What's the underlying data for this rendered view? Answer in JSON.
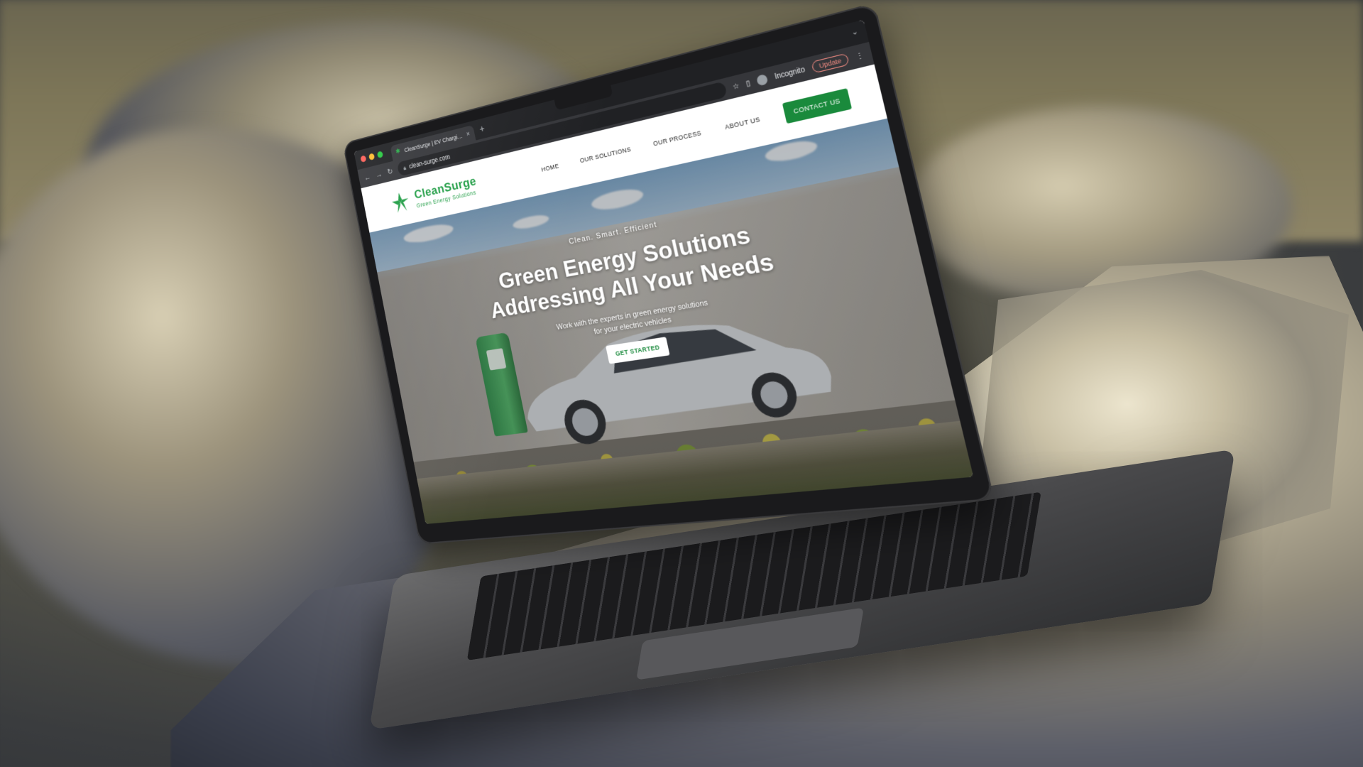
{
  "browser": {
    "tab_title": "CleanSurge | EV Charging, Sol",
    "tab_close": "×",
    "new_tab": "+",
    "chevron": "⌄",
    "url": "clean-surge.com",
    "incognito_label": "Incognito",
    "update_label": "Update"
  },
  "site": {
    "brand_name": "CleanSurge",
    "brand_tagline": "Green Energy Solutions",
    "nav": {
      "home": "HOME",
      "solutions": "OUR SOLUTIONS",
      "process": "OUR PROCESS",
      "about": "ABOUT US",
      "contact": "CONTACT US"
    },
    "hero": {
      "eyebrow": "Clean. Smart. Efficient",
      "title_line1": "Green Energy Solutions",
      "title_line2": "Addressing All Your Needs",
      "subtitle_line1": "Work with the experts in green energy solutions",
      "subtitle_line2": "for your electric vehicles",
      "cta": "GET STARTED"
    }
  },
  "icons": {
    "back": "arrow-left-icon",
    "forward": "arrow-right-icon",
    "reload": "reload-icon",
    "lock": "lock-icon",
    "star": "star-icon",
    "sidepanel": "sidepanel-icon",
    "incognito": "incognito-icon",
    "menu": "kebab-menu-icon",
    "logo": "leaf-star-logo-icon"
  },
  "colors": {
    "brand_green": "#1f9d44",
    "button_green": "#1a8a3c",
    "browser_dark": "#202124"
  }
}
